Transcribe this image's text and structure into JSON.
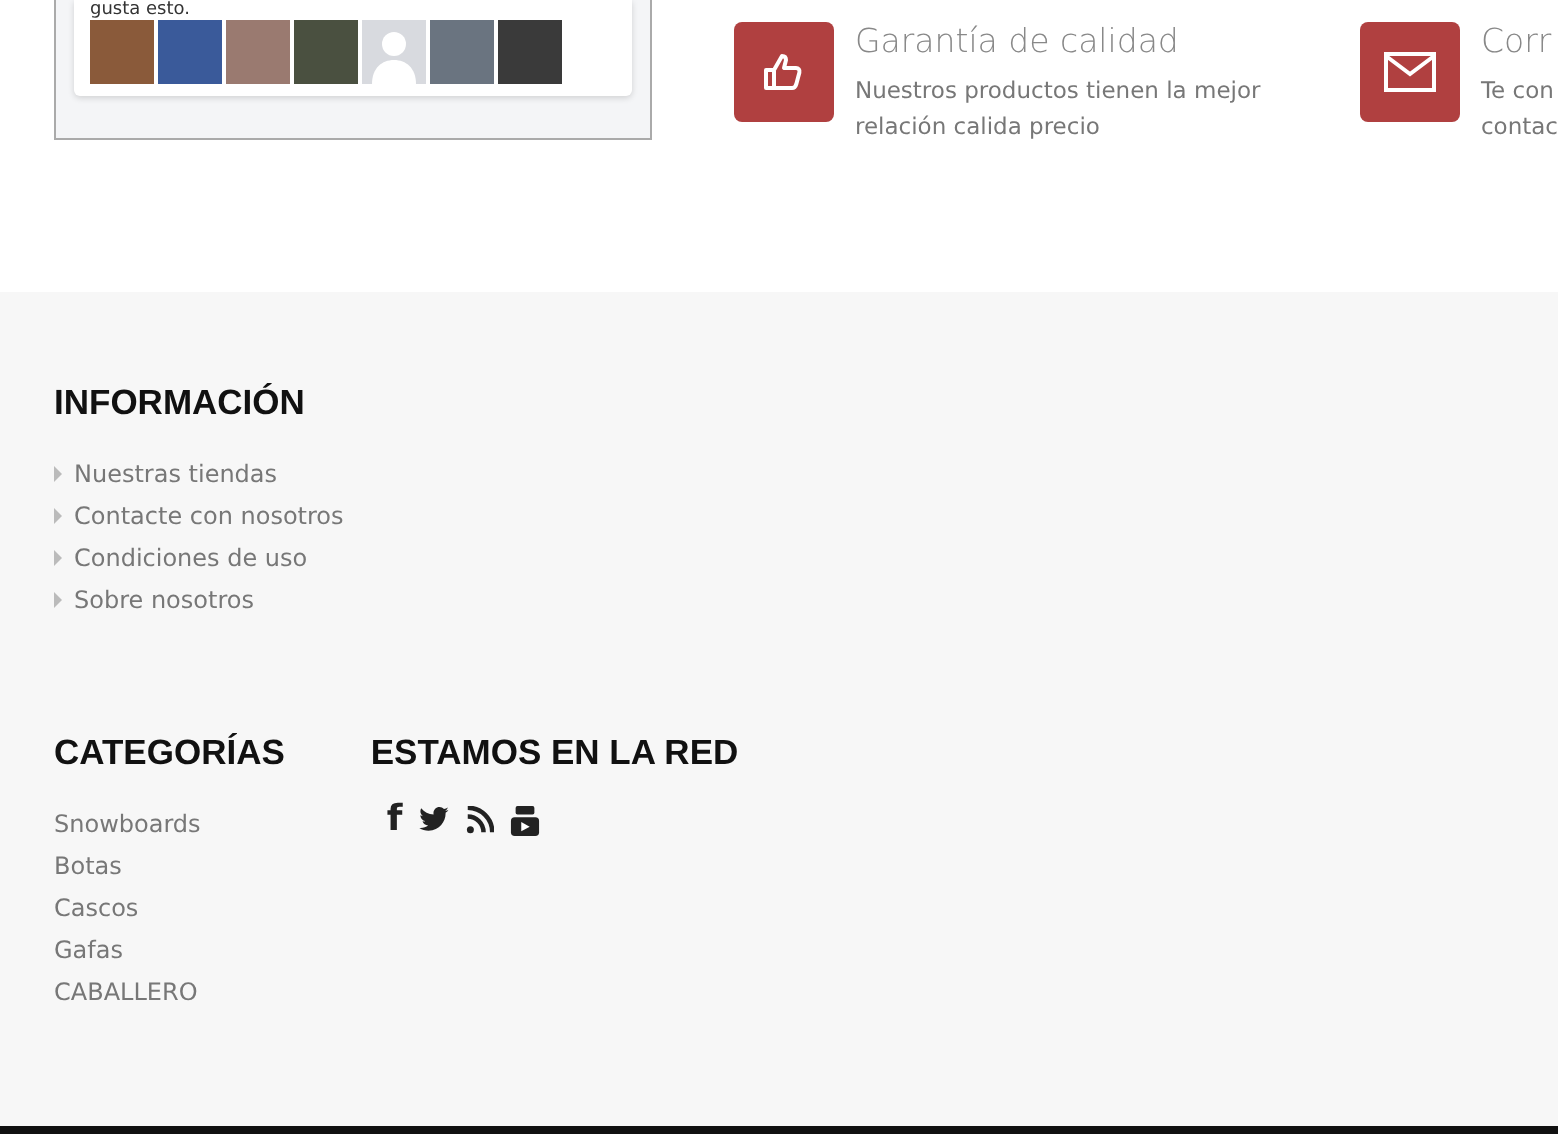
{
  "likes_box": {
    "text": "gusta esto.",
    "avatars": [
      {
        "kind": "photo"
      },
      {
        "kind": "photo"
      },
      {
        "kind": "photo"
      },
      {
        "kind": "photo"
      },
      {
        "kind": "silhouette"
      },
      {
        "kind": "photo"
      },
      {
        "kind": "photo"
      }
    ]
  },
  "features": [
    {
      "kind": "thumb",
      "title": "Garantía de calidad",
      "lines": [
        "Nuestros productos tienen la mejor",
        "relación calida precio"
      ]
    },
    {
      "kind": "mail",
      "title": "Corr",
      "lines": [
        "Te con",
        "contac"
      ]
    }
  ],
  "footer": {
    "information": {
      "heading": "INFORMACIÓN",
      "links": [
        "Nuestras tiendas",
        "Contacte con nosotros",
        "Condiciones de uso",
        "Sobre nosotros"
      ]
    },
    "categories": {
      "heading": "CATEGORÍAS",
      "links": [
        "Snowboards",
        "Botas",
        "Cascos",
        "Gafas",
        "CABALLERO"
      ]
    },
    "social": {
      "heading": "ESTAMOS EN LA RED",
      "icons": [
        {
          "kind": "facebook",
          "glyph": "f"
        },
        {
          "kind": "bird"
        },
        {
          "kind": "rss"
        },
        {
          "kind": "video"
        }
      ]
    }
  }
}
